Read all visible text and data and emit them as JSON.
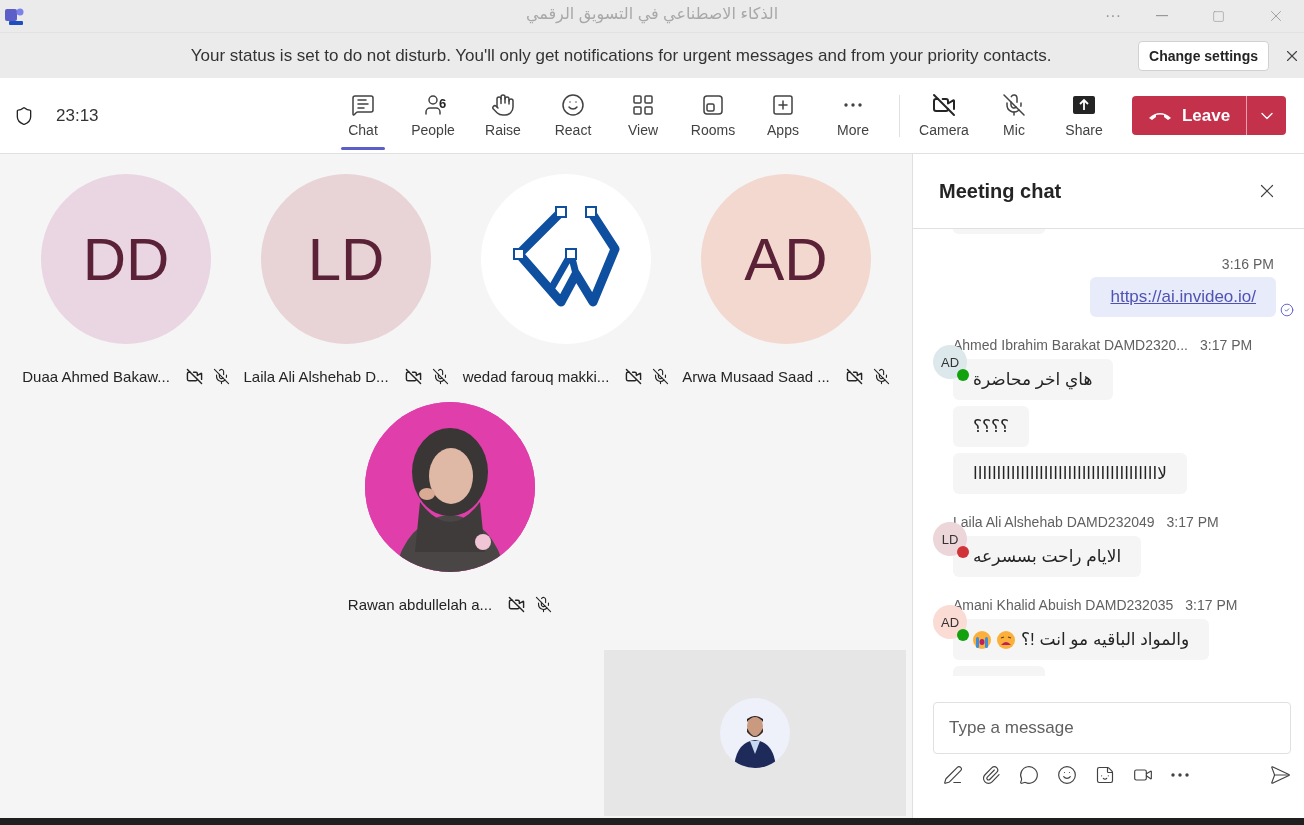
{
  "window": {
    "title": "الذكاء الاصطناعي في التسويق الرقمي",
    "more": "···"
  },
  "notification": {
    "text": "Your status is set to do not disturb. You'll only get notifications for urgent messages and from your priority contacts.",
    "action": "Change settings"
  },
  "toolbar": {
    "timer": "23:13",
    "items": [
      {
        "kind": "chat",
        "label": "Chat",
        "selected": true
      },
      {
        "kind": "people",
        "label": "People",
        "badge": "6",
        "selected": false
      },
      {
        "kind": "raise",
        "label": "Raise",
        "selected": false
      },
      {
        "kind": "react",
        "label": "React",
        "selected": false
      },
      {
        "kind": "view",
        "label": "View",
        "selected": false
      },
      {
        "kind": "rooms",
        "label": "Rooms",
        "selected": false
      },
      {
        "kind": "apps",
        "label": "Apps",
        "selected": false
      },
      {
        "kind": "more",
        "label": "More",
        "selected": false
      }
    ],
    "devices": [
      {
        "kind": "camera",
        "label": "Camera"
      },
      {
        "kind": "mic",
        "label": "Mic"
      },
      {
        "kind": "share",
        "label": "Share"
      }
    ],
    "leave": "Leave"
  },
  "participants": [
    {
      "name": "Duaa Ahmed Bakaw...",
      "kind": "initials",
      "initials": "DD",
      "color": "#ead5e2"
    },
    {
      "name": "Laila Ali Alshehab D...",
      "kind": "initials",
      "initials": "LD",
      "color": "#e8d3d6"
    },
    {
      "name": "wedad farouq makki...",
      "kind": "logo"
    },
    {
      "name": "Arwa Musaad Saad ...",
      "kind": "initials",
      "initials": "AD",
      "color": "#f2d8cf"
    },
    {
      "name": "Rawan abdullelah a...",
      "kind": "picture"
    }
  ],
  "chat": {
    "title": "Meeting chat",
    "messages": [
      {
        "kind": "cut_top"
      },
      {
        "kind": "own",
        "time": "3:16 PM",
        "text": "https://ai.invideo.io/"
      },
      {
        "kind": "group",
        "sender": "Ahmed Ibrahim Barakat DAMD2320...",
        "time": "3:17 PM",
        "avatar": {
          "initials": "AD",
          "color": "#dde8ec"
        },
        "presence": {
          "color": "#13a10e"
        },
        "bubbles": [
          {
            "text": "هاي اخر محاضرة"
          },
          {
            "text": "؟؟؟؟"
          },
          {
            "text": "لاااااااااااااااااااااااااااااااااااااااا"
          }
        ]
      },
      {
        "kind": "group",
        "sender": "Laila Ali Alshehab DAMD232049",
        "time": "3:17 PM",
        "avatar": {
          "initials": "LD",
          "color": "#ecd6d9"
        },
        "presence": {
          "color": "#d13438"
        },
        "bubbles": [
          {
            "text": "الايام راحت بسسرعه"
          }
        ]
      },
      {
        "kind": "group",
        "sender": "Amani Khalid Abuish DAMD232035",
        "time": "3:17 PM",
        "avatar": {
          "initials": "AD",
          "color": "#fadcd5"
        },
        "presence": {
          "color": "#13a10e"
        },
        "bubbles": [
          {
            "text": "والمواد الباقيه مو انت !؟",
            "emojis": [
              {
                "kind": "weary"
              },
              {
                "kind": "crying"
              }
            ]
          }
        ]
      },
      {
        "kind": "cut_bottom"
      }
    ],
    "compose": {
      "placeholder": "Type a message"
    }
  }
}
